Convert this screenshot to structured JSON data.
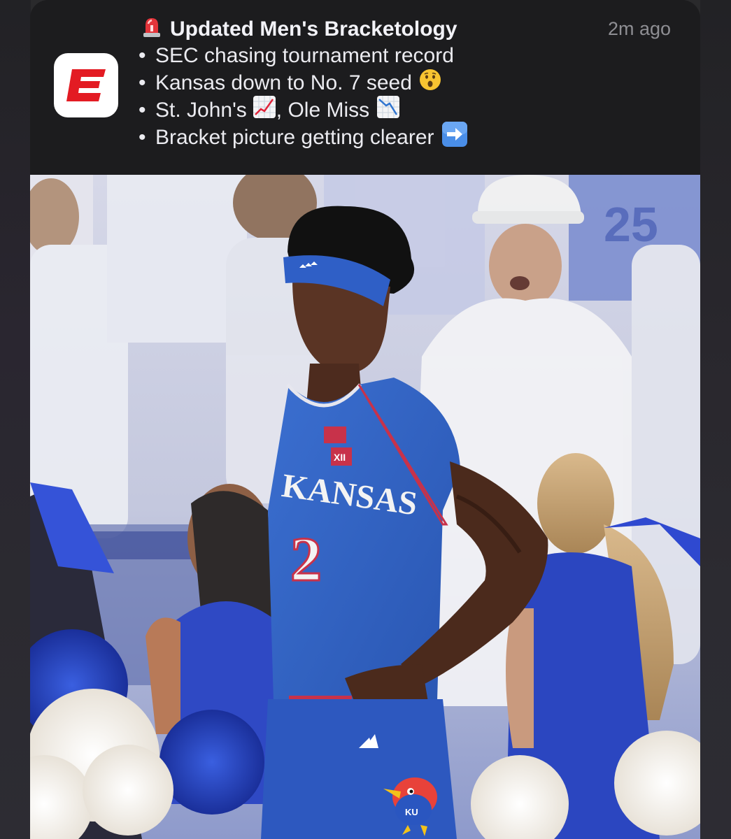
{
  "notification": {
    "app_name": "ESPN",
    "time": "2m ago",
    "title_emoji": "rotating-light",
    "title": "Updated Men's Bracketology",
    "bullets": [
      {
        "text": "SEC chasing tournament record",
        "emoji": ""
      },
      {
        "text": "Kansas down to No. 7 seed",
        "emoji": "hushed-face"
      },
      {
        "text": "St. John's",
        "emoji": "chart-increasing",
        "suffix": ", Ole Miss",
        "suffix_emoji": "chart-decreasing"
      },
      {
        "text": "Bracket picture getting clearer",
        "emoji": "right-arrow"
      }
    ],
    "bullet_char": "•"
  },
  "photo": {
    "jersey_text": "KANSAS",
    "jersey_number": "2",
    "jersey_patch": "XII",
    "shorts_logo_text": "KU"
  },
  "colors": {
    "espn_red": "#e31b23",
    "card_bg": "#1c1c1e",
    "jersey_blue": "#2f5fc0",
    "time_gray": "#8e8e93"
  }
}
